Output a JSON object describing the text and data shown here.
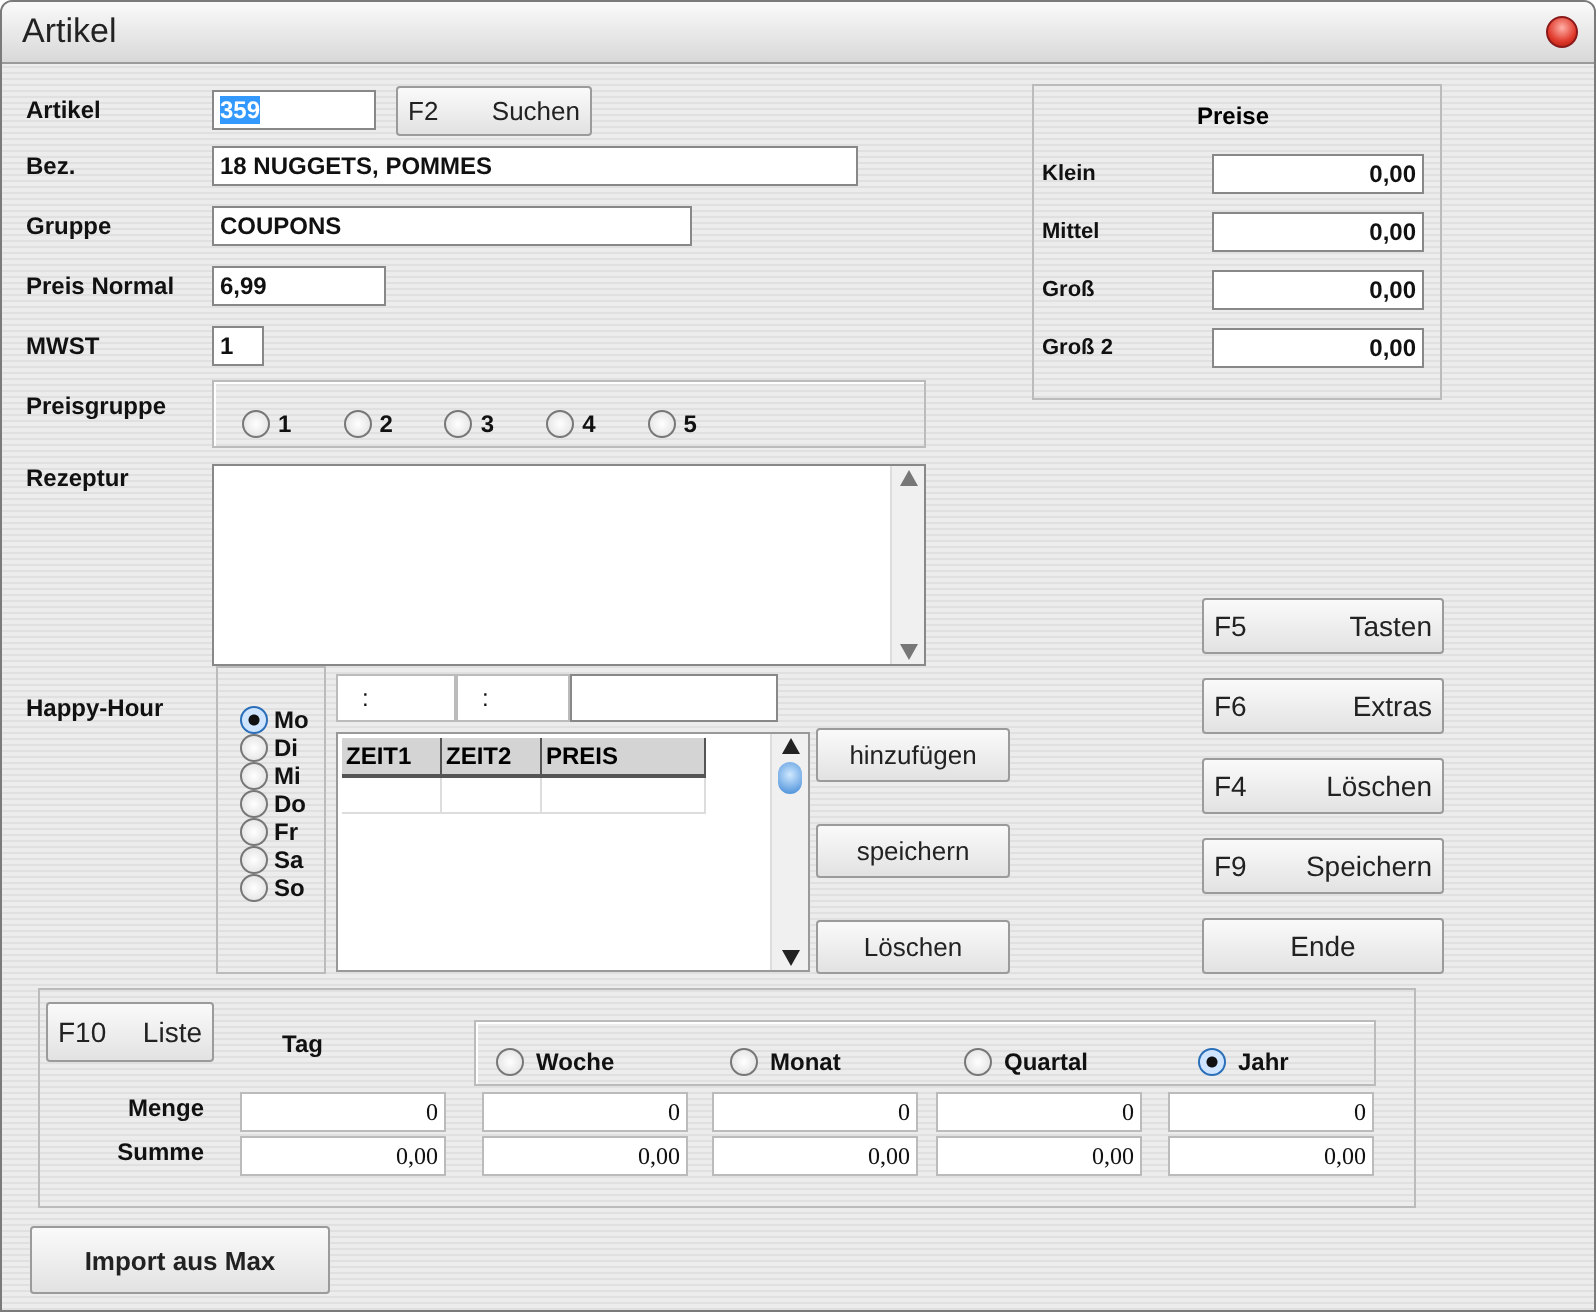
{
  "window": {
    "title": "Artikel"
  },
  "fields": [
    {
      "label": "Artikel",
      "value": "359",
      "highlighted": true
    },
    {
      "label": "Bez.",
      "value": "18 NUGGETS, POMMES",
      "highlighted": false
    },
    {
      "label": "Gruppe",
      "value": "COUPONS",
      "highlighted": false
    },
    {
      "label": "Preis Normal",
      "value": "6,99",
      "highlighted": false
    },
    {
      "label": "MWST",
      "value": "1",
      "highlighted": false
    }
  ],
  "search_button": {
    "key": "F2",
    "label": "Suchen"
  },
  "preisgruppe": {
    "label": "Preisgruppe",
    "options": [
      {
        "label": "1",
        "selected": false
      },
      {
        "label": "2",
        "selected": false
      },
      {
        "label": "3",
        "selected": false
      },
      {
        "label": "4",
        "selected": false
      },
      {
        "label": "5",
        "selected": false
      }
    ]
  },
  "rezeptur": {
    "label": "Rezeptur"
  },
  "happy_hour": {
    "label": "Happy-Hour",
    "days": [
      {
        "label": "Mo",
        "selected": true
      },
      {
        "label": "Di",
        "selected": false
      },
      {
        "label": "Mi",
        "selected": false
      },
      {
        "label": "Do",
        "selected": false
      },
      {
        "label": "Fr",
        "selected": false
      },
      {
        "label": "Sa",
        "selected": false
      },
      {
        "label": "So",
        "selected": false
      }
    ],
    "time_fields": [
      ":",
      ":"
    ],
    "columns": [
      "ZEIT1",
      "ZEIT2",
      "PREIS"
    ],
    "buttons": [
      "hinzufügen",
      "speichern",
      "Löschen"
    ]
  },
  "preise": {
    "title": "Preise",
    "rows": [
      {
        "label": "Klein",
        "value": "0,00"
      },
      {
        "label": "Mittel",
        "value": "0,00"
      },
      {
        "label": "Groß",
        "value": "0,00"
      },
      {
        "label": "Groß 2",
        "value": "0,00"
      }
    ]
  },
  "actions": [
    {
      "key": "F5",
      "label": "Tasten"
    },
    {
      "key": "F6",
      "label": "Extras"
    },
    {
      "key": "F4",
      "label": "Löschen"
    },
    {
      "key": "F9",
      "label": "Speichern"
    },
    {
      "label": "Ende"
    }
  ],
  "stats": {
    "list_button": {
      "key": "F10",
      "label": "Liste"
    },
    "tag_label": "Tag",
    "periods": [
      {
        "label": "Woche",
        "selected": false
      },
      {
        "label": "Monat",
        "selected": false
      },
      {
        "label": "Quartal",
        "selected": false
      },
      {
        "label": "Jahr",
        "selected": true
      }
    ],
    "rows": [
      {
        "label": "Menge",
        "values": [
          "0",
          "0",
          "0",
          "0",
          "0"
        ]
      },
      {
        "label": "Summe",
        "values": [
          "0,00",
          "0,00",
          "0,00",
          "0,00",
          "0,00"
        ]
      }
    ]
  },
  "import_button": "Import aus Max"
}
